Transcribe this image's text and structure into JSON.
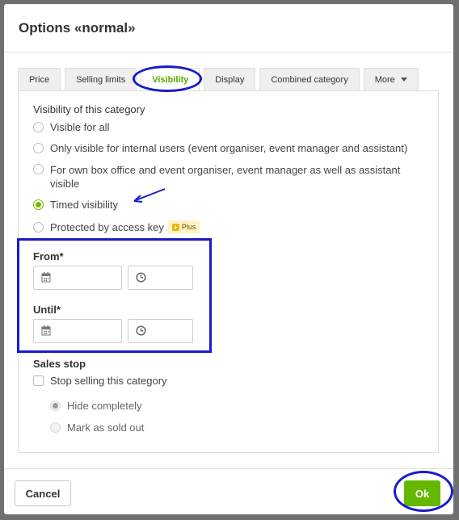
{
  "dialog": {
    "title": "Options «normal»"
  },
  "tabs": [
    {
      "label": "Price"
    },
    {
      "label": "Selling limits"
    },
    {
      "label": "Visibility"
    },
    {
      "label": "Display"
    },
    {
      "label": "Combined category"
    },
    {
      "label": "More"
    }
  ],
  "visibility": {
    "heading": "Visibility of this category",
    "options": [
      {
        "label": "Visible for all"
      },
      {
        "label": "Only visible for internal users (event organiser, event manager and assistant)"
      },
      {
        "label": "For own box office and event organiser, event manager as well as assistant visible"
      },
      {
        "label": "Timed visibility"
      },
      {
        "label": "Protected by access key"
      }
    ],
    "selected": "Timed visibility",
    "badge": {
      "label": "Plus"
    }
  },
  "from": {
    "label": "From*",
    "date": "",
    "time": ""
  },
  "until": {
    "label": "Until*",
    "date": "",
    "time": ""
  },
  "sales_stop": {
    "heading": "Sales stop",
    "checkbox_label": "Stop selling this category",
    "sub_options": [
      {
        "label": "Hide completely"
      },
      {
        "label": "Mark as sold out"
      }
    ]
  },
  "footer": {
    "cancel_label": "Cancel",
    "ok_label": "Ok"
  },
  "colors": {
    "accent": "#65b800",
    "annotation": "#1a1acc"
  },
  "icons": {
    "date": "calendar-icon",
    "time": "clock-icon",
    "more": "caret-down-icon"
  }
}
